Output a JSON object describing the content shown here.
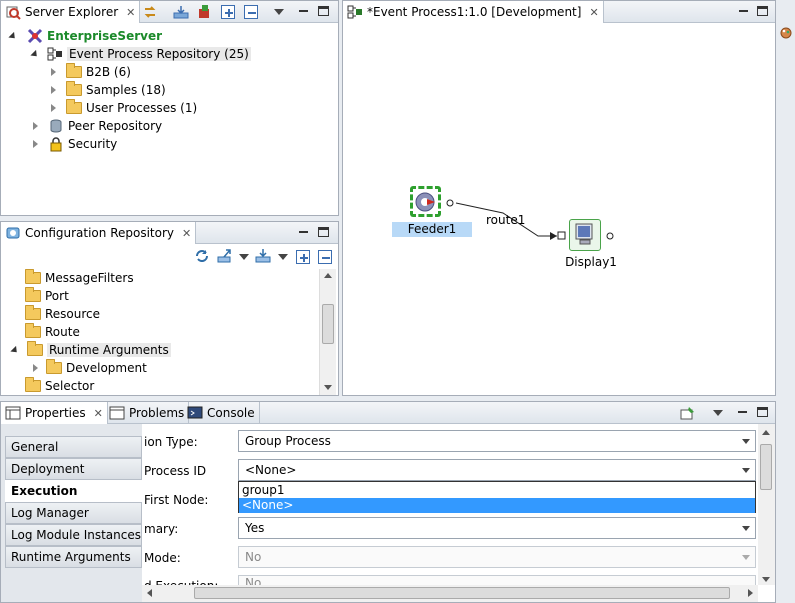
{
  "server_explorer": {
    "tab_label": "Server Explorer",
    "root": "EnterpriseServer",
    "event_repo": "Event Process Repository (25)",
    "children": [
      "B2B (6)",
      "Samples (18)",
      "User Processes (1)"
    ],
    "peer": "Peer Repository",
    "security": "Security"
  },
  "editor": {
    "tab_label": "*Event Process1:1.0 [Development]",
    "nodes": {
      "feeder": "Feeder1",
      "display": "Display1"
    },
    "route_label": "route1"
  },
  "config_repo": {
    "tab_label": "Configuration Repository",
    "items": [
      "MessageFilters",
      "Port",
      "Resource",
      "Route",
      "Runtime Arguments",
      "Development",
      "Selector"
    ]
  },
  "bottom_tabs": {
    "properties": "Properties",
    "problems": "Problems",
    "console": "Console"
  },
  "properties": {
    "side_tabs": [
      "General",
      "Deployment",
      "Execution",
      "Log Manager",
      "Log Module Instances",
      "Runtime Arguments"
    ],
    "active_tab": "Execution",
    "labels": [
      "ion Type:",
      "Process ID",
      "First Node:",
      "mary:",
      "Mode:",
      "d Execution:"
    ],
    "values": [
      "Group Process",
      "<None>",
      "Yes",
      "No",
      "No"
    ],
    "dropdown_options": [
      "group1",
      "<None>"
    ],
    "selected_option": "<None>"
  },
  "colors": {
    "selection": "#3399ff",
    "feeder_label_bg": "#b8d9f7",
    "root_green": "#1b8a2a"
  }
}
